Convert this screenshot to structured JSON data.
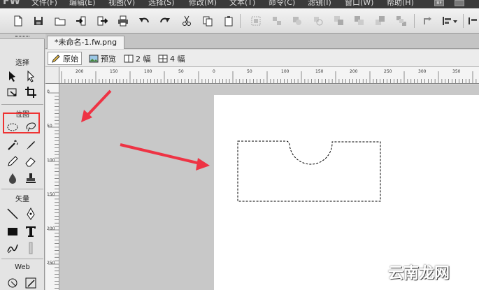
{
  "menu": {
    "logo": "FW",
    "items": [
      "文件(F)",
      "编辑(E)",
      "视图(V)",
      "选择(S)",
      "修改(M)",
      "文本(T)",
      "命令(C)",
      "滤镜(I)",
      "窗口(W)",
      "帮助(H)"
    ],
    "badge": "BF"
  },
  "tools": {
    "sections": {
      "select": "选择",
      "bitmap": "位图",
      "vector": "矢量",
      "web": "Web"
    }
  },
  "document": {
    "tab_title": "*未命名-1.fw.png"
  },
  "viewbar": {
    "original": "原始",
    "preview": "预览",
    "two_up": "2 幅",
    "four_up": "4 幅"
  },
  "rulers": {
    "h_labels": [
      "200",
      "150",
      "100",
      "50",
      "0",
      "50",
      "100",
      "150",
      "200",
      "250",
      "300",
      "350",
      "400"
    ],
    "v_labels": [
      "0",
      "50",
      "100",
      "150",
      "200",
      "250"
    ]
  },
  "watermark": {
    "text": "云南龙网"
  },
  "colors": {
    "highlight": "#ee3333",
    "arrow": "#ee3344",
    "selection": "#000000"
  }
}
